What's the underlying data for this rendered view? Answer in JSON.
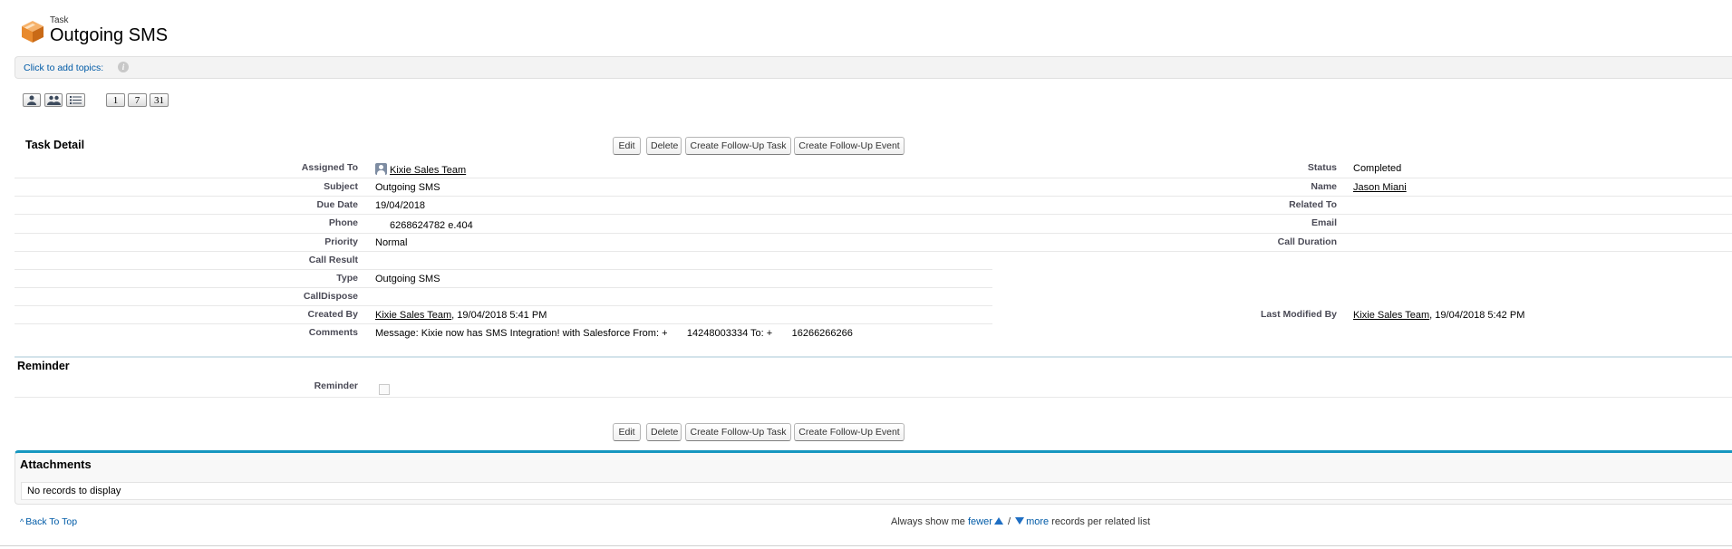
{
  "header": {
    "object_type": "Task",
    "title": "Outgoing SMS",
    "icon": "task-box-icon"
  },
  "topics": {
    "link_text": "Click to add topics:",
    "info_icon": "i"
  },
  "view_buttons": {
    "icons": [
      "single-user-icon",
      "multi-user-icon",
      "list-view-icon"
    ],
    "days": [
      "1",
      "7",
      "31"
    ]
  },
  "task_detail": {
    "title": "Task Detail",
    "buttons": [
      "Edit",
      "Delete",
      "Create Follow-Up Task",
      "Create Follow-Up Event"
    ],
    "left_fields": [
      {
        "label": "Assigned To",
        "value": "Kixie Sales Team",
        "link": true,
        "user_icon": true
      },
      {
        "label": "Subject",
        "value": "Outgoing SMS"
      },
      {
        "label": "Due Date",
        "value": "19/04/2018"
      },
      {
        "label": "Phone",
        "value": "6268624782 e.404"
      },
      {
        "label": "Priority",
        "value": "Normal"
      },
      {
        "label": "Call Result",
        "value": ""
      },
      {
        "label": "Type",
        "value": "Outgoing SMS"
      },
      {
        "label": "CallDispose",
        "value": ""
      },
      {
        "label": "Created By",
        "value_link": "Kixie Sales Team",
        "value_suffix": ", 19/04/2018 5:41 PM"
      },
      {
        "label": "Comments",
        "value": "Message: Kixie now has SMS Integration! with Salesforce From: +       14248003334 To: +       16266266266"
      }
    ],
    "right_fields": [
      {
        "label": "Status",
        "value": "Completed"
      },
      {
        "label": "Name",
        "value": "Jason Miani",
        "link": true
      },
      {
        "label": "Related To",
        "value": ""
      },
      {
        "label": "Email",
        "value": ""
      },
      {
        "label": "Call Duration",
        "value": ""
      }
    ],
    "last_modified": {
      "label": "Last Modified By",
      "value_link": "Kixie Sales Team",
      "value_suffix": ", 19/04/2018 5:42 PM"
    }
  },
  "reminder": {
    "title": "Reminder",
    "label": "Reminder",
    "checked": false
  },
  "attachments": {
    "title": "Attachments",
    "empty_text": "No records to display"
  },
  "footer": {
    "back_to_top": "Back To Top",
    "pref_prefix": "Always show me ",
    "fewer": "fewer",
    "separator": " / ",
    "more": "more",
    "pref_suffix": " records per related list"
  },
  "colors": {
    "link_blue": "#015ba7",
    "section_accent": "#1797c0",
    "label_gray": "#4a4a56"
  }
}
